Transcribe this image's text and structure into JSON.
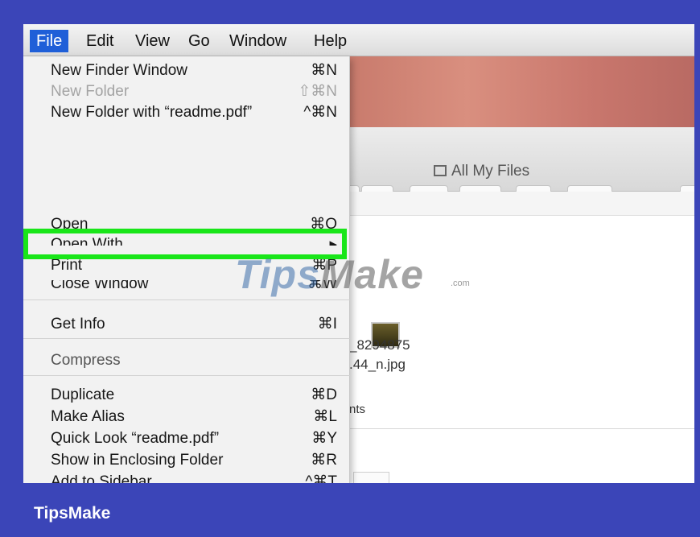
{
  "menubar": {
    "items": [
      "File",
      "Edit",
      "View",
      "Go",
      "Window",
      "Help"
    ],
    "active": "File"
  },
  "finder": {
    "window_title": "All My Files",
    "nav_back": "<",
    "nav_forward": ">",
    "file_name_line1": "_8294875",
    "file_name_line2": ".44_n.jpg",
    "section_label": "nts"
  },
  "file_menu": {
    "items": [
      {
        "label": "New Finder Window",
        "shortcut": "⌘N",
        "enabled": true
      },
      {
        "label": "New Folder",
        "shortcut": "⇧⌘N",
        "enabled": false
      },
      {
        "label": "New Folder with “readme.pdf”",
        "shortcut": "^⌘N",
        "enabled": true
      },
      {
        "label": "Open",
        "shortcut": "⌘O",
        "enabled": true
      },
      {
        "label": "Open With",
        "shortcut": "▸",
        "enabled": true
      },
      {
        "label": "Print",
        "shortcut": "⌘P",
        "enabled": true,
        "highlighted": true
      },
      {
        "label": "Close Window",
        "shortcut": "⌘W",
        "enabled": true
      },
      {
        "label": "Get Info",
        "shortcut": "⌘I",
        "enabled": true
      },
      {
        "label": "Compress",
        "shortcut": "",
        "enabled": true
      },
      {
        "label": "Duplicate",
        "shortcut": "⌘D",
        "enabled": true
      },
      {
        "label": "Make Alias",
        "shortcut": "⌘L",
        "enabled": true
      },
      {
        "label": "Quick Look “readme.pdf”",
        "shortcut": "⌘Y",
        "enabled": true
      },
      {
        "label": "Show in Enclosing Folder",
        "shortcut": "⌘R",
        "enabled": true
      },
      {
        "label": "Add to Sidebar",
        "shortcut": "^⌘T",
        "enabled": true
      }
    ]
  },
  "watermark": {
    "brand_a": "Tips",
    "brand_b": "Make",
    "suffix": ".com"
  },
  "footer": {
    "brand": "TipsMake"
  },
  "colors": {
    "frame": "#3b45b8",
    "highlight": "#19e619",
    "menu_active": "#1f5fd8"
  }
}
